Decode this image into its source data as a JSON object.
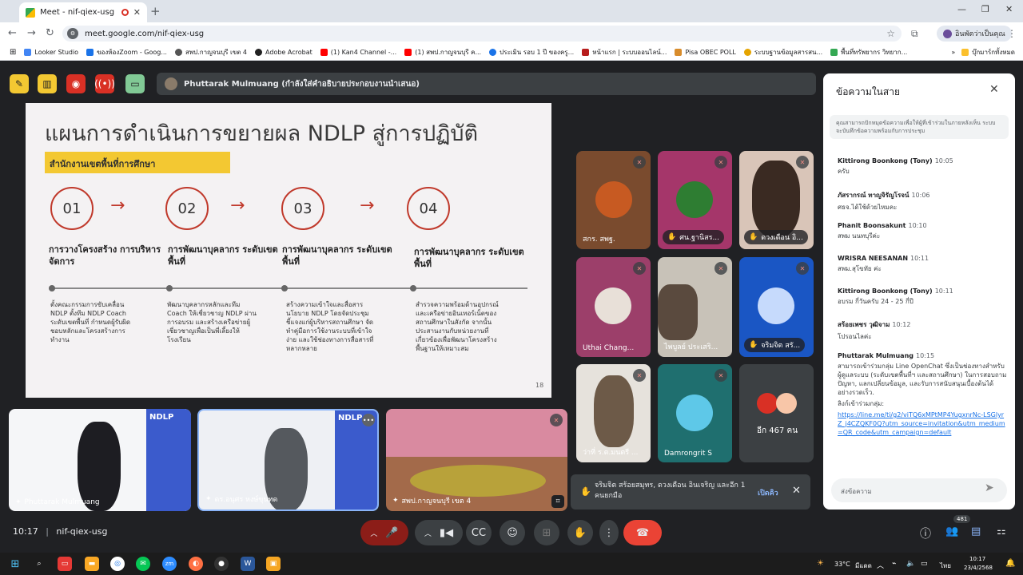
{
  "browser": {
    "tab_title": "Meet - nif-qiex-usg",
    "new_tab": "+",
    "url": "meet.google.com/nif-qiex-usg",
    "profile_label": "อินพัตว่าเป็นคุณ",
    "bookmarks": [
      "Looker Studio",
      "ของห้องZoom - Goog...",
      "สพป.กาญจนบุรี เขต 4",
      "Adobe Acrobat",
      "(1) Kan4 Channel -...",
      "(1) สพป.กาญจนบุรี ค...",
      "ประเมิน รอบ 1 ปี ของครู...",
      "หน้าแรก | ระบบออนไลน์...",
      "Pisa OBEC POLL",
      "ระบบฐานข้อมูลสารสน...",
      "พื้นที่ทรัพยากร วิทยาก..."
    ],
    "all_bookmarks": "บุ๊กมาร์กทั้งหมด",
    "more_bookmarks": "»"
  },
  "meet": {
    "presenter_banner": "Phuttarak Mulmuang (กำลังใส่คำอธิบายประกอบงานนำเสนอ)",
    "meeting_time": "10:17",
    "meeting_code": "nif-qiex-usg",
    "participant_count": "481",
    "slide": {
      "title": "แผนการดำเนินการขยายผล NDLP สู่การปฏิบัติ",
      "banner": "สำนักงานเขตพื้นที่การศึกษา",
      "page": "18",
      "steps": [
        {
          "num": "01",
          "heading": "การวางโครงสร้าง การบริหารจัดการ",
          "desc": "ตั้งคณะกรรมการขับเคลื่อน NDLP ตั้งทีม NDLP Coach ระดับเขตพื้นที่ กำหนดผู้รับผิดชอบหลักและโครงสร้างการทำงาน"
        },
        {
          "num": "02",
          "heading": "การพัฒนาบุคลากร ระดับเขตพื้นที่",
          "desc": "พัฒนาบุคลากรหลักและทีม Coach ให้เชี่ยวชาญ NDLP ผ่านการอบรม และสร้างเครือข่ายผู้เชี่ยวชาญเพื่อเป็นพี่เลี้ยงให้โรงเรียน"
        },
        {
          "num": "03",
          "heading": "การพัฒนาบุคลากร ระดับเขตพื้นที่",
          "desc": "สร้างความเข้าใจและสื่อสารนโยบาย NDLP โดยจัดประชุมชี้แจงแก่ผู้บริหารสถานศึกษา จัดทำคู่มือการใช้งานระบบที่เข้าใจง่าย และใช้ช่องทางการสื่อสารที่หลากหลาย"
        },
        {
          "num": "04",
          "heading": "การพัฒนาบุคลากร ระดับเขตพื้นที่",
          "desc": "สำรวจความพร้อมด้านอุปกรณ์และเครือข่ายอินเทอร์เน็ตของสถานศึกษาในสังกัด จากนั้นประสานงานกับหน่วยงานที่เกี่ยวข้องเพื่อพัฒนาโครงสร้างพื้นฐานให้เหมาะสม"
        }
      ]
    },
    "tiles": [
      {
        "name": "สกร. สพฐ."
      },
      {
        "name": "ศน.ฐานิสร..."
      },
      {
        "name": "ดวงเดือน อิ..."
      },
      {
        "name": "Uthai Chang..."
      },
      {
        "name": "ไพบูลย์ ประเสริ..."
      },
      {
        "name": "จริมจิต สรั..."
      },
      {
        "name": "ว่าที่ ร.ต.มนตรี ..."
      },
      {
        "name": "Damrongrit S"
      },
      {
        "name": "อีก 467 คน"
      }
    ],
    "bottom_tiles": [
      {
        "name": "Phuttarak Mulmuang",
        "logo": "NDLP"
      },
      {
        "name": "ดร.อนุศร หงษ์ขุนทด",
        "logo": "NDLP"
      },
      {
        "name": "สพป.กาญจนบุรี เขต 4"
      }
    ],
    "notification": {
      "text": "จริมจิต สร้อยสมุทร, ดวงเดือน อินเจริญ และอีก 1 คนยกมือ",
      "action": "เปิดคิว"
    }
  },
  "chat": {
    "title": "ข้อความในสาย",
    "info": "คุณสามารถปักหมุดข้อความเพื่อให้ผู้ที่เข้าร่วมในภายหลังเห็น ระบบจะบันทึกข้อความพร้อมกับการประชุม",
    "input_placeholder": "ส่งข้อความ",
    "messages": [
      {
        "sender": "Kittirong Boonkong (Tony)",
        "time": "10:05",
        "text": "ครับ"
      },
      {
        "sender": "ภัสรากรณ์ ทาญจิรัญโรจน์",
        "time": "10:06",
        "text": "ศธจ.ได้ใช้ด้วยไหมคะ"
      },
      {
        "sender": "Phanit Boonsakunt",
        "time": "10:10",
        "text": "สพม นนทบุรีค่ะ"
      },
      {
        "sender": "WRISRA NEESANAN",
        "time": "10:11",
        "text": "สพม.สุโขทัย ค่ะ"
      },
      {
        "sender": "Kittirong Boonkong (Tony)",
        "time": "10:11",
        "text": "อบรม กี่วันครับ   24 - 25   กี่ปี"
      },
      {
        "sender": "สร้อยเพชร วุฒิจาม",
        "time": "10:12",
        "text": "โปรอนไลค่ะ"
      },
      {
        "sender": "Phuttarak Mulmuang",
        "time": "10:15",
        "text": "สามารถเข้าร่วมกลุ่ม Line OpenChat ซึ่งเป็นช่องทางสำหรับผู้ดูแลระบบ (ระดับเขตพื้นที่ฯ และสถานศึกษา) ในการสอบถามปัญหา, แลกเปลี่ยนข้อมูล, และรับการสนับสนุนเบื้องต้นได้อย่างรวดเร็ว.",
        "link_label": "ลิงก์เข้าร่วมกลุ่ม:",
        "link": "https://line.me/ti/g2/viTQ6xMPtMP4YugxnrNc-LSGlyrZ_j4CZQKF0Q?utm_source=invitation&utm_medium=QR_code&utm_campaign=default"
      }
    ]
  },
  "taskbar": {
    "weather": "33°C",
    "weather_desc": "มีแดด",
    "lang": "ไทย",
    "clock_time": "10:17",
    "clock_date": "23/4/2568"
  },
  "colors": {
    "accent": "#1a73e8",
    "end_call": "#ea4335",
    "slide_accent": "#c0392b",
    "banner": "#f3c832"
  }
}
